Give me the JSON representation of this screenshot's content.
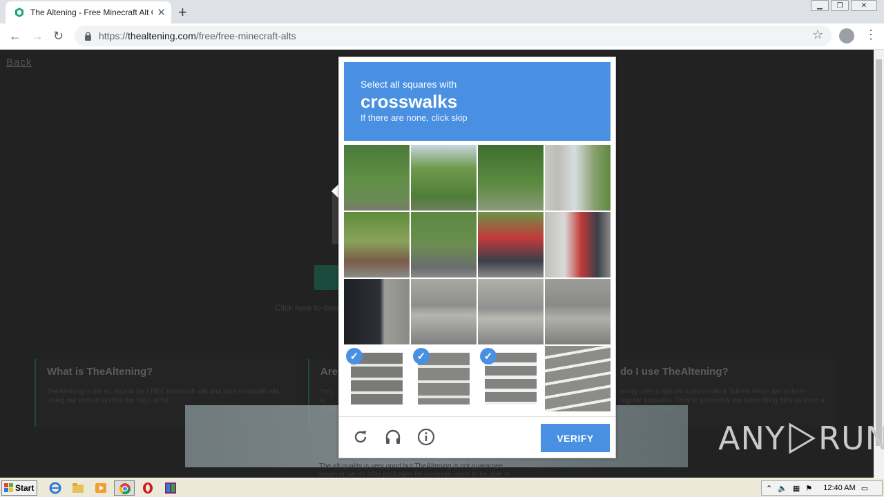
{
  "browser": {
    "tab_title": "The Altening - Free Minecraft Alt Gen",
    "url_scheme": "https://",
    "url_domain": "thealtening.com",
    "url_path": "/free/free-minecraft-alts"
  },
  "page": {
    "back_link": "Back",
    "download_text": "Click here to dow",
    "features": [
      {
        "title": "What is TheAltening?",
        "text": "TheAltening is the #1 source for FREE minecraft alts and paid minecraft alts. Using our unique system the days of ha"
      },
      {
        "title": "Are",
        "text": "Yes, a servi"
      },
      {
        "title": "do I use TheAltening?",
        "text": "ening uses a special system called Tokens which are nt from regular accounts. They're practically the same thing bles us to do a lot more cool things!..."
      }
    ],
    "bottom_text_1": "The alt quality is very good but TheAltening is not guarantee",
    "bottom_text_2": "however we do offer packages for premium users to be able to"
  },
  "captcha": {
    "instruction_line": "Select all squares with",
    "target_word": "crosswalks",
    "skip_hint": "If there are none, click skip",
    "selected_tiles": [
      12,
      13,
      14
    ],
    "verify_label": "VERIFY",
    "icons": [
      "refresh-icon",
      "headphones-icon",
      "info-icon"
    ]
  },
  "watermark": {
    "text_left": "ANY",
    "text_right": "RUN"
  },
  "taskbar": {
    "start_label": "Start",
    "clock": "12:40 AM"
  },
  "colors": {
    "captcha_blue": "#4a90e2",
    "page_bg": "#222222",
    "feature_accent": "#1f4a3a"
  }
}
